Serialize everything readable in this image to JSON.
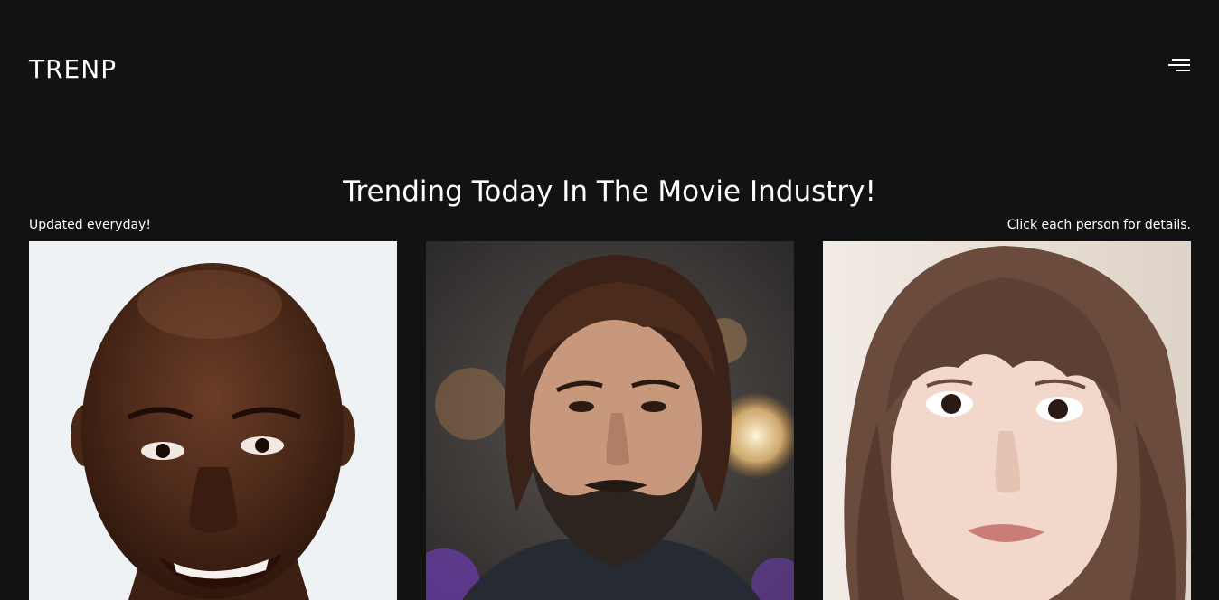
{
  "brand": {
    "logo": "TRENP"
  },
  "nav": {
    "menu_icon": "hamburger-menu-icon"
  },
  "main": {
    "heading": "Trending Today In The Movie Industry!",
    "subtitle_left": "Updated everyday!",
    "subtitle_right": "Click each person for details."
  },
  "people": [
    {
      "photo": "portrait-photo"
    },
    {
      "photo": "portrait-photo"
    },
    {
      "photo": "portrait-photo"
    }
  ],
  "colors": {
    "background": "#121212",
    "text": "#ffffff"
  }
}
